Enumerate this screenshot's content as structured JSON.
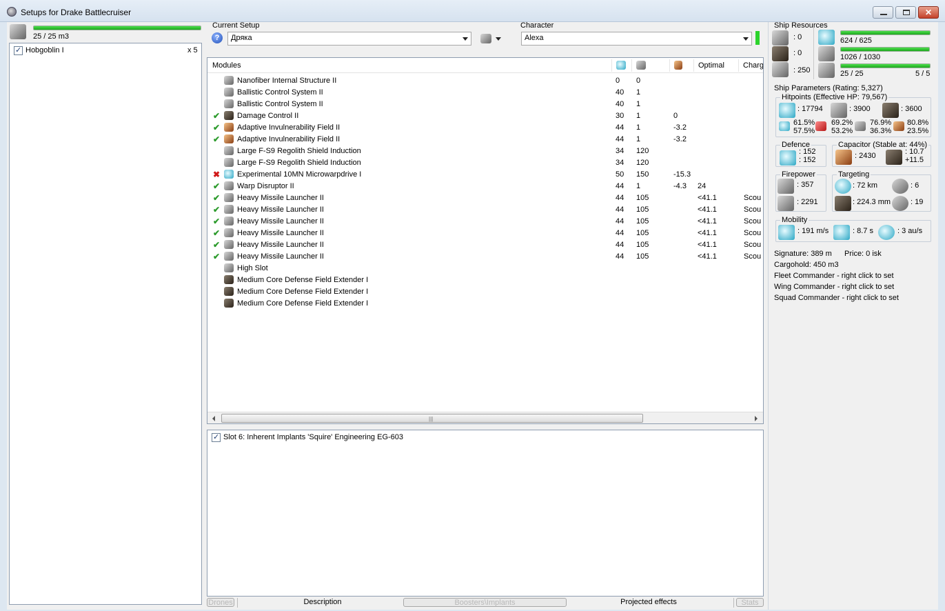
{
  "window": {
    "title": "Setups for Drake Battlecruiser"
  },
  "drones": {
    "capacity": "25 / 25 m3",
    "bar_fill": 1.0,
    "items": [
      {
        "name": "Hobgoblin I",
        "count": "x 5"
      }
    ]
  },
  "setup": {
    "label": "Current Setup",
    "value": "Дряка"
  },
  "character": {
    "label": "Character",
    "value": "Alexa"
  },
  "modules": {
    "columns": {
      "name": "Modules",
      "optimal": "Optimal",
      "charge": "Charg"
    },
    "rows": [
      {
        "status": "",
        "icon": "gray",
        "name": "Nanofiber Internal Structure II",
        "cpu": "0",
        "power": "0",
        "cap": "",
        "optimal": "",
        "charge": ""
      },
      {
        "status": "",
        "icon": "gray",
        "name": "Ballistic Control System II",
        "cpu": "40",
        "power": "1",
        "cap": "",
        "optimal": "",
        "charge": ""
      },
      {
        "status": "",
        "icon": "gray",
        "name": "Ballistic Control System II",
        "cpu": "40",
        "power": "1",
        "cap": "",
        "optimal": "",
        "charge": ""
      },
      {
        "status": "ok",
        "icon": "dark",
        "name": "Damage Control II",
        "cpu": "30",
        "power": "1",
        "cap": "0",
        "optimal": "",
        "charge": ""
      },
      {
        "status": "ok",
        "icon": "orange",
        "name": "Adaptive Invulnerability Field II",
        "cpu": "44",
        "power": "1",
        "cap": "-3.2",
        "optimal": "",
        "charge": ""
      },
      {
        "status": "ok",
        "icon": "orange",
        "name": "Adaptive Invulnerability Field II",
        "cpu": "44",
        "power": "1",
        "cap": "-3.2",
        "optimal": "",
        "charge": ""
      },
      {
        "status": "",
        "icon": "gray",
        "name": "Large F-S9 Regolith Shield Induction",
        "cpu": "34",
        "power": "120",
        "cap": "",
        "optimal": "",
        "charge": ""
      },
      {
        "status": "",
        "icon": "gray",
        "name": "Large F-S9 Regolith Shield Induction",
        "cpu": "34",
        "power": "120",
        "cap": "",
        "optimal": "",
        "charge": ""
      },
      {
        "status": "off",
        "icon": "cyan",
        "name": "Experimental 10MN Microwarpdrive I",
        "cpu": "50",
        "power": "150",
        "cap": "-15.3",
        "optimal": "",
        "charge": ""
      },
      {
        "status": "ok",
        "icon": "gray",
        "name": "Warp Disruptor II",
        "cpu": "44",
        "power": "1",
        "cap": "-4.3",
        "optimal": "24",
        "charge": ""
      },
      {
        "status": "ok",
        "icon": "gray",
        "name": "Heavy Missile Launcher II",
        "cpu": "44",
        "power": "105",
        "cap": "",
        "optimal": "<41.1",
        "charge": "Scou"
      },
      {
        "status": "ok",
        "icon": "gray",
        "name": "Heavy Missile Launcher II",
        "cpu": "44",
        "power": "105",
        "cap": "",
        "optimal": "<41.1",
        "charge": "Scou"
      },
      {
        "status": "ok",
        "icon": "gray",
        "name": "Heavy Missile Launcher II",
        "cpu": "44",
        "power": "105",
        "cap": "",
        "optimal": "<41.1",
        "charge": "Scou"
      },
      {
        "status": "ok",
        "icon": "gray",
        "name": "Heavy Missile Launcher II",
        "cpu": "44",
        "power": "105",
        "cap": "",
        "optimal": "<41.1",
        "charge": "Scou"
      },
      {
        "status": "ok",
        "icon": "gray",
        "name": "Heavy Missile Launcher II",
        "cpu": "44",
        "power": "105",
        "cap": "",
        "optimal": "<41.1",
        "charge": "Scou"
      },
      {
        "status": "ok",
        "icon": "gray",
        "name": "Heavy Missile Launcher II",
        "cpu": "44",
        "power": "105",
        "cap": "",
        "optimal": "<41.1",
        "charge": "Scou"
      },
      {
        "status": "",
        "icon": "gray",
        "name": "High Slot",
        "cpu": "",
        "power": "",
        "cap": "",
        "optimal": "",
        "charge": ""
      },
      {
        "status": "",
        "icon": "dark",
        "name": "Medium Core Defense Field Extender I",
        "cpu": "",
        "power": "",
        "cap": "",
        "optimal": "",
        "charge": ""
      },
      {
        "status": "",
        "icon": "dark",
        "name": "Medium Core Defense Field Extender I",
        "cpu": "",
        "power": "",
        "cap": "",
        "optimal": "",
        "charge": ""
      },
      {
        "status": "",
        "icon": "dark",
        "name": "Medium Core Defense Field Extender I",
        "cpu": "",
        "power": "",
        "cap": "",
        "optimal": "",
        "charge": ""
      }
    ]
  },
  "implants": {
    "items": [
      {
        "name": "Slot 6: Inherent Implants 'Squire' Engineering EG-603"
      }
    ]
  },
  "tabs": {
    "drones": "Drones",
    "description": "Description",
    "boosters": "Boosters\\Implants",
    "projected": "Projected effects",
    "stats": "Stats"
  },
  "resources": {
    "title": "Ship Resources",
    "turret": ": 0",
    "launcher": ": 0",
    "calibration": ": 250",
    "cpu": "624 / 625",
    "cpu_fill": 0.998,
    "power": "1026 / 1030",
    "power_fill": 0.996,
    "drone_bw": "25 / 25",
    "drone_bw_fill": 1.0,
    "drone_count": "5 / 5"
  },
  "params": {
    "title": "Ship Parameters (Rating: 5,327)",
    "hitpoints_title": "Hitpoints (Effective HP: 79,567)",
    "shield_hp": ": 17794",
    "armor_hp": ": 3900",
    "structure_hp": ": 3600",
    "res_em_a": "61.5%",
    "res_em_b": "57.5%",
    "res_th_a": "69.2%",
    "res_th_b": "53.2%",
    "res_ki_a": "76.9%",
    "res_ki_b": "36.3%",
    "res_ex_a": "80.8%",
    "res_ex_b": "23.5%",
    "defence_title": "Defence",
    "defence_a": ": 152",
    "defence_b": ": 152",
    "capacitor_title": "Capacitor (Stable at: 44%)",
    "cap_amount": ": 2430",
    "cap_a": ": 10.7",
    "cap_b": "+11.5",
    "firepower_title": "Firepower",
    "fire_a": ": 357",
    "fire_b": ": 2291",
    "targeting_title": "Targeting",
    "range": ": 72 km",
    "targets": ": 6",
    "scan_res": ": 224.3 mm",
    "sensor": ": 19",
    "mobility_title": "Mobility",
    "speed": ": 191 m/s",
    "align": ": 8.7 s",
    "warp": ": 3 au/s",
    "signature": "Signature: 389 m",
    "price": "Price: 0 isk",
    "cargo": "Cargohold: 450 m3",
    "fleet": "Fleet Commander - right click to set",
    "wing": "Wing Commander - right click to set",
    "squad": "Squad Commander - right click to set"
  }
}
